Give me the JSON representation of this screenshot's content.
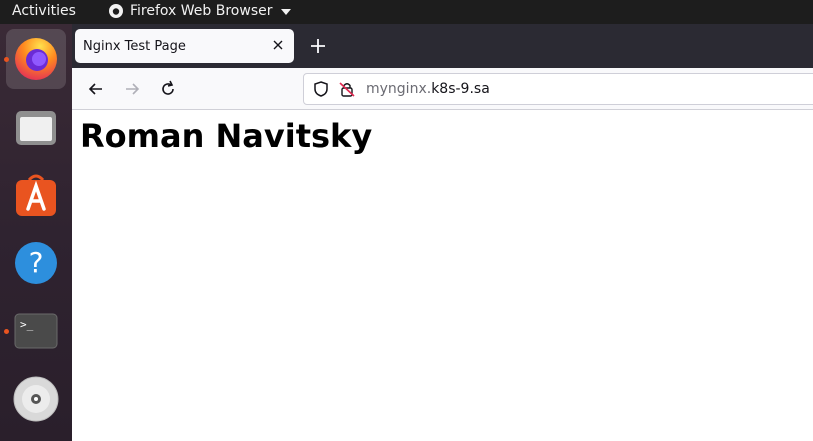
{
  "topbar": {
    "activities_label": "Activities",
    "app_menu_label": "Firefox Web Browser"
  },
  "dock": {
    "items": [
      {
        "icon": "firefox-icon",
        "label": "Firefox",
        "running": true,
        "active": true
      },
      {
        "icon": "files-icon",
        "label": "Files",
        "running": false,
        "active": false
      },
      {
        "icon": "software-store-icon",
        "label": "Ubuntu Software",
        "running": false,
        "active": false
      },
      {
        "icon": "help-icon",
        "label": "Help",
        "running": false,
        "active": false
      },
      {
        "icon": "terminal-icon",
        "label": "Terminal",
        "running": true,
        "active": false
      },
      {
        "icon": "dvd-icon",
        "label": "Disc",
        "running": false,
        "active": false
      }
    ],
    "help_glyph": "?",
    "terminal_glyph": ">_"
  },
  "browser": {
    "tab": {
      "title": "Nginx Test Page"
    },
    "url": {
      "prefix": "mynginx.",
      "host": "k8s-9.sa"
    }
  },
  "page": {
    "heading": "Roman Navitsky"
  },
  "colors": {
    "topbar_bg": "#1d1d1d",
    "dock_bg": "#2f2330",
    "accent_orange": "#e95420",
    "tabstrip_bg": "#2b2a33"
  }
}
